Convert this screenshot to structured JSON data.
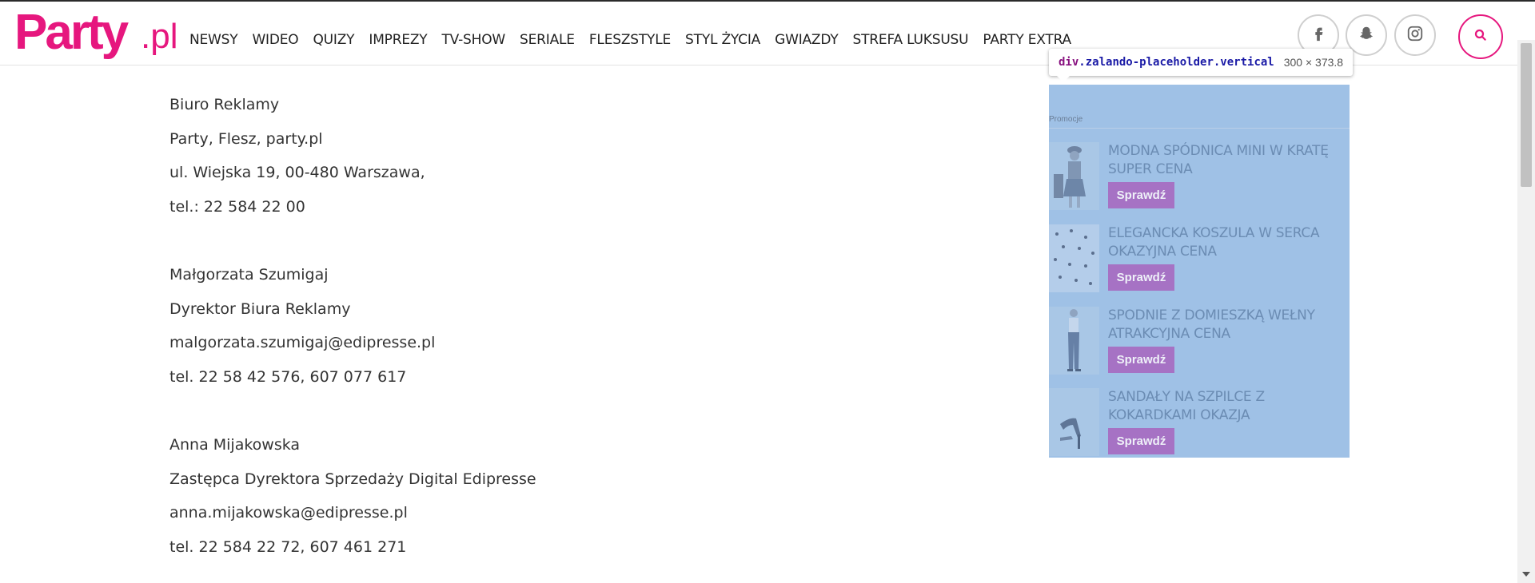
{
  "brand": {
    "logo_main": "Party",
    "logo_suffix": ".pl",
    "accent_color": "#e6177e"
  },
  "nav": {
    "items": [
      "NEWSY",
      "WIDEO",
      "QUIZY",
      "IMPREZY",
      "TV-SHOW",
      "SERIALE",
      "FLESZSTYLE",
      "STYL ŻYCIA",
      "GWIAZDY",
      "STREFA LUKSUSU",
      "PARTY EXTRA"
    ]
  },
  "header_icons": [
    "facebook-icon",
    "snapchat-icon",
    "instagram-icon",
    "search-icon"
  ],
  "contacts": [
    {
      "lines": [
        "Biuro Reklamy",
        "Party, Flesz, party.pl",
        "ul. Wiejska 19, 00-480 Warszawa,",
        "tel.: 22 584 22 00"
      ]
    },
    {
      "lines": [
        "Małgorzata Szumigaj",
        "Dyrektor Biura Reklamy",
        "malgorzata.szumigaj@edipresse.pl",
        "tel. 22 58 42 576, 607 077 617"
      ]
    },
    {
      "lines": [
        "Anna Mijakowska",
        "Zastępca Dyrektora Sprzedaży Digital Edipresse",
        "anna.mijakowska@edipresse.pl",
        "tel. 22 584 22 72, 607 461 271"
      ]
    }
  ],
  "devtools_tooltip": {
    "tag": "div",
    "class": ".zalando-placeholder.vertical",
    "dims": "300 × 373.8"
  },
  "promo": {
    "label": "Promocje",
    "items": [
      {
        "title": "MODNA SPÓDNICA MINI W KRATĘ SUPER CENA",
        "button": "Sprawdź"
      },
      {
        "title": "ELEGANCKA KOSZULA W SERCA OKAZYJNA CENA",
        "button": "Sprawdź"
      },
      {
        "title": "SPODNIE Z DOMIESZKĄ WEŁNY ATRAKCYJNA CENA",
        "button": "Sprawdź"
      },
      {
        "title": "SANDAŁY NA SZPILCE Z KOKARDKAMI OKAZJA",
        "button": "Sprawdź"
      }
    ]
  }
}
